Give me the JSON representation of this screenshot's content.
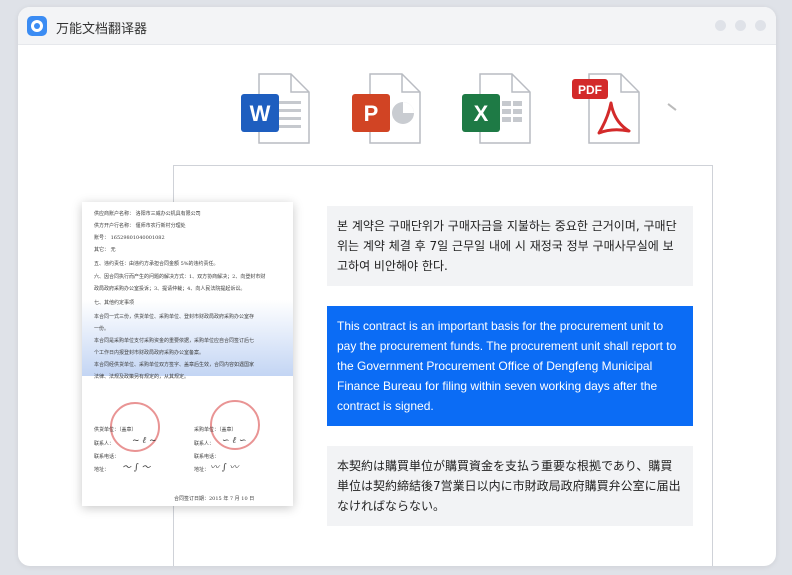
{
  "app": {
    "title": "万能文档翻译器",
    "icon": "translator-app-icon"
  },
  "file_types": [
    {
      "name": "word",
      "badge": "W",
      "color": "#1e5ebf"
    },
    {
      "name": "powerpoint",
      "badge": "P",
      "color": "#d14424"
    },
    {
      "name": "excel",
      "badge": "X",
      "color": "#1e7a45"
    },
    {
      "name": "pdf",
      "badge": "PDF",
      "color": "#d32a2a"
    }
  ],
  "document_preview": {
    "lines": [
      "供应商账户名称：  洛阳市三威办公机具有限公司",
      "供方开户行名称：  偃师市农行新村分理处",
      "账号：  16529801040001082",
      "其它：  无",
      "五、违约责任：由违约方承担合同金额 5%的违约责任。",
      "六、因合同执行而产生的问题的解决方式：1、双方协商解决；2、向登封市财",
      "政局政府采购办公室投诉；3、提请仲裁；4、向人民法院提起诉讼。",
      "七、其他约定事项",
      "本合同一式三份，供货单位、采购单位、登封市财政局政府采购办公室存",
      "一份。",
      "本合同是采购单位支付采购资金的重要依据，采购单位应自合同签订后七",
      "个工作日内报登封市财政局政府采购办公室备案。",
      "本合同经供货单位、采购单位双方签字、盖章后生效，合同内容如遇国家",
      "法律、法规及政策另有规定的，从其规定。",
      "供货单位：（盖章）",
      "采购单位：（盖章）",
      "联系人：",
      "联系电话：",
      "地址：",
      "合同签订日期：2015 年 7 月 10 日"
    ]
  },
  "translations": {
    "korean": "본 계약은 구매단위가 구매자금을 지불하는 중요한 근거이며, 구매단위는 계약 체결 후 7일 근무일 내에 시 재정국 정부 구매사무실에 보고하여 비안해야 한다.",
    "english": "This contract is an important basis for the procurement unit to pay the procurement funds. The procurement unit shall report to the Government Procurement Office of Dengfeng Municipal Finance Bureau for filing within seven working days after the contract is signed.",
    "japanese": "本契約は購買単位が購買資金を支払う重要な根拠であり、購買単位は契約締結後7営業日以内に市財政局政府購買弁公室に届出なければならない。"
  },
  "colors": {
    "accent": "#0b6cf5",
    "block_bg": "#f2f3f5"
  }
}
